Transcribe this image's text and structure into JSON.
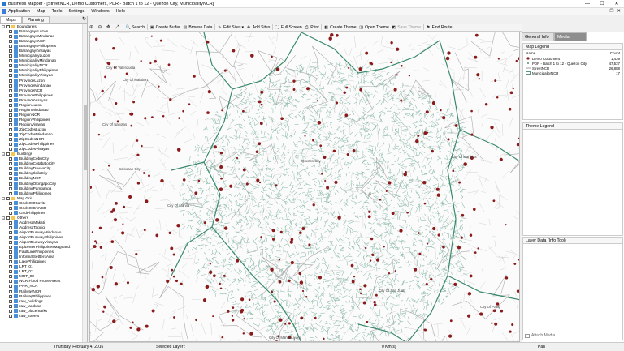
{
  "window": {
    "title": "Business Mapper - [StreetNCR, Demo Customers, PDR - Batch 1 to 12 - Quezon City, MunicipalityNCR]",
    "min": "—",
    "max": "☐",
    "close": "✕"
  },
  "menu": {
    "items": [
      "Application",
      "Map",
      "Tools",
      "Settings",
      "Windows",
      "Help"
    ],
    "right_controls": [
      "—",
      "❐",
      "✕"
    ]
  },
  "left_panel": {
    "tabs": [
      "Maps",
      "Planning"
    ],
    "tree": [
      {
        "level": 0,
        "type": "group",
        "label": "Boundaries"
      },
      {
        "level": 1,
        "type": "layer",
        "label": "BarangaysLuzon"
      },
      {
        "level": 1,
        "type": "layer",
        "label": "BarangaysMindanao"
      },
      {
        "level": 1,
        "type": "layer",
        "label": "BarangaysNCR"
      },
      {
        "level": 1,
        "type": "layer",
        "label": "BarangaysPhilippines"
      },
      {
        "level": 1,
        "type": "layer",
        "label": "BarangaysVisayas"
      },
      {
        "level": 1,
        "type": "layer",
        "label": "MunicipalityLuzon"
      },
      {
        "level": 1,
        "type": "layer",
        "label": "MunicipalityMindanao"
      },
      {
        "level": 1,
        "type": "layer",
        "label": "MunicipalityNCR",
        "checked": true
      },
      {
        "level": 1,
        "type": "layer",
        "label": "MunicipalityPhilippines"
      },
      {
        "level": 1,
        "type": "layer",
        "label": "MunicipalityVisayas"
      },
      {
        "level": 1,
        "type": "layer",
        "label": "ProvinceLuzon"
      },
      {
        "level": 1,
        "type": "layer",
        "label": "ProvinceMindanao"
      },
      {
        "level": 1,
        "type": "layer",
        "label": "ProvinceNCR"
      },
      {
        "level": 1,
        "type": "layer",
        "label": "ProvincePhilippines"
      },
      {
        "level": 1,
        "type": "layer",
        "label": "ProvinceVisayas"
      },
      {
        "level": 1,
        "type": "layer",
        "label": "RegionLuzon"
      },
      {
        "level": 1,
        "type": "layer",
        "label": "RegionMindanao"
      },
      {
        "level": 1,
        "type": "layer",
        "label": "RegionNCR"
      },
      {
        "level": 1,
        "type": "layer",
        "label": "RegionPhilippines"
      },
      {
        "level": 1,
        "type": "layer",
        "label": "RegionVisayas"
      },
      {
        "level": 1,
        "type": "layer",
        "label": "ZipCodesLuzon"
      },
      {
        "level": 1,
        "type": "layer",
        "label": "ZipCodesMindanao"
      },
      {
        "level": 1,
        "type": "layer",
        "label": "ZipCodesNCR"
      },
      {
        "level": 1,
        "type": "layer",
        "label": "ZipCodesPhilippines"
      },
      {
        "level": 1,
        "type": "layer",
        "label": "ZipCodesVisayas"
      },
      {
        "level": 0,
        "type": "group",
        "label": "Buildings"
      },
      {
        "level": 1,
        "type": "layer",
        "label": "BuildingCebuCity"
      },
      {
        "level": 1,
        "type": "layer",
        "label": "BuildingCotabatoCity"
      },
      {
        "level": 1,
        "type": "layer",
        "label": "BuildingDavaoCity"
      },
      {
        "level": 1,
        "type": "layer",
        "label": "BuildingIloiloCity"
      },
      {
        "level": 1,
        "type": "layer",
        "label": "BuildingNCR"
      },
      {
        "level": 1,
        "type": "layer",
        "label": "BuildingOlongapoCity"
      },
      {
        "level": 1,
        "type": "layer",
        "label": "BuildingPampanga"
      },
      {
        "level": 1,
        "type": "layer",
        "label": "BuildingPhilippines"
      },
      {
        "level": 0,
        "type": "group",
        "label": "Map Grid"
      },
      {
        "level": 1,
        "type": "layer",
        "label": "Grid1000Cavite"
      },
      {
        "level": 1,
        "type": "layer",
        "label": "Grid1000mNCR"
      },
      {
        "level": 1,
        "type": "layer",
        "label": "GridPhilippines"
      },
      {
        "level": 0,
        "type": "group",
        "label": "Others"
      },
      {
        "level": 1,
        "type": "layer",
        "label": "AddressMakati"
      },
      {
        "level": 1,
        "type": "layer",
        "label": "AddressTaguig"
      },
      {
        "level": 1,
        "type": "layer",
        "label": "AirportRunwayMindanao"
      },
      {
        "level": 1,
        "type": "layer",
        "label": "AirportRunwayPhilippines"
      },
      {
        "level": 1,
        "type": "layer",
        "label": "AirportRunwayVisayas"
      },
      {
        "level": 1,
        "type": "layer",
        "label": "EpicenterPhilippinesMag6and7"
      },
      {
        "level": 1,
        "type": "layer",
        "label": "FaultLinePhilippines"
      },
      {
        "level": 1,
        "type": "layer",
        "label": "InformalSettlersArea"
      },
      {
        "level": 1,
        "type": "layer",
        "label": "LakePhilippines"
      },
      {
        "level": 1,
        "type": "layer",
        "label": "LRT_01"
      },
      {
        "level": 1,
        "type": "layer",
        "label": "LRT_02"
      },
      {
        "level": 1,
        "type": "layer",
        "label": "MRT_03"
      },
      {
        "level": 1,
        "type": "layer",
        "label": "NCR Flood Prone Areas"
      },
      {
        "level": 1,
        "type": "layer",
        "label": "PNR_NCR"
      },
      {
        "level": 1,
        "type": "layer",
        "label": "RailwayNCR"
      },
      {
        "level": 1,
        "type": "layer",
        "label": "RailwayPhilippines"
      },
      {
        "level": 1,
        "type": "layer",
        "label": "raw_buildings"
      },
      {
        "level": 1,
        "type": "layer",
        "label": "raw_landuse"
      },
      {
        "level": 1,
        "type": "layer",
        "label": "raw_placemarks"
      },
      {
        "level": 1,
        "type": "layer",
        "label": "raw_streets"
      }
    ]
  },
  "toolbar": {
    "zoom_in": "⊕",
    "zoom_out": "⊖",
    "pan": "✥",
    "full_extent": "⤢",
    "buttons": [
      {
        "icon": "🔍",
        "label": "Search",
        "name": "search-button"
      },
      {
        "icon": "▣",
        "label": "Create Buffer",
        "name": "create-buffer-button"
      },
      {
        "icon": "▤",
        "label": "Browse Data",
        "name": "browse-data-button"
      },
      {
        "icon": "✎",
        "label": "Edit Sites",
        "name": "edit-sites-button",
        "dropdown": true
      },
      {
        "icon": "✚",
        "label": "Add Sites",
        "name": "add-sites-button"
      },
      {
        "icon": "⛶",
        "label": "Full Screen",
        "name": "full-screen-button"
      },
      {
        "icon": "⎙",
        "label": "Print",
        "name": "print-button"
      },
      {
        "icon": "◧",
        "label": "Create Theme",
        "name": "create-theme-button"
      },
      {
        "icon": "◨",
        "label": "Open Theme",
        "name": "open-theme-button"
      },
      {
        "icon": "◩",
        "label": "Save Theme",
        "name": "save-theme-button",
        "disabled": true
      },
      {
        "icon": "⚑",
        "label": "Find Route",
        "name": "find-route-button"
      }
    ]
  },
  "map": {
    "place_labels": [
      "City Of Valenzuela",
      "City Of Malabon",
      "City Of Navotas",
      "Caloocan City",
      "City Of Manila",
      "City Of Marikina",
      "City Of Mandaluyong",
      "City Of San Juan",
      "Quezon City",
      "City Of Pasig"
    ],
    "street_color": "#7fb3a0",
    "road_color": "#aaaaaa",
    "boundary_color": "#3a8a6a",
    "customer_color": "#8b1a1a"
  },
  "right_panel": {
    "tabs": [
      "General Info",
      "Media"
    ],
    "map_legend": {
      "title": "Map Legend",
      "col_name": "Name",
      "col_count": "Count",
      "rows": [
        {
          "name": "Demo Customers",
          "count": "1,439",
          "sym": "dot",
          "color": "#8b1a1a"
        },
        {
          "name": "PDR - Batch 1 to 12 - Quezon City",
          "count": "47,537",
          "sym": "dot-small",
          "color": "#5a8f7b"
        },
        {
          "name": "StreetNCR",
          "count": "26,888",
          "sym": "line",
          "color": "#888888"
        },
        {
          "name": "MunicipalityNCR",
          "count": "17",
          "sym": "box",
          "color": "#2e7d5b"
        }
      ]
    },
    "theme_legend": {
      "title": "Theme Legend"
    },
    "layer_data": {
      "title": "Layer Data (Info Tool)"
    },
    "attach_media": "Attach Media"
  },
  "status": {
    "date": "Thursday, February 4, 2016",
    "selected_layer": "Selected Layer :",
    "distance": "0 Km(s)",
    "mode": "Pan"
  }
}
